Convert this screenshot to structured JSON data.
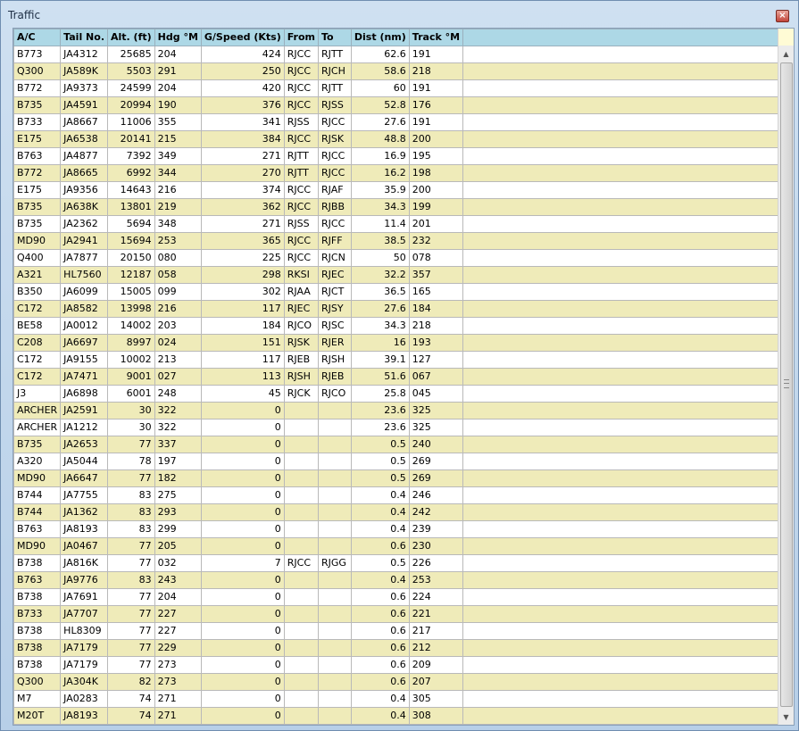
{
  "window": {
    "title": "Traffic",
    "close_glyph": "×"
  },
  "table": {
    "columns": [
      "A/C",
      "Tail No.",
      "Alt. (ft)",
      "Hdg °M",
      "G/Speed (Kts)",
      "From",
      "To",
      "Dist (nm)",
      "Track °M"
    ],
    "rows": [
      [
        "B773",
        "JA4312",
        "25685",
        "204",
        "424",
        "RJCC",
        "RJTT",
        "62.6",
        "191"
      ],
      [
        "Q300",
        "JA589K",
        "5503",
        "291",
        "250",
        "RJCC",
        "RJCH",
        "58.6",
        "218"
      ],
      [
        "B772",
        "JA9373",
        "24599",
        "204",
        "420",
        "RJCC",
        "RJTT",
        "60",
        "191"
      ],
      [
        "B735",
        "JA4591",
        "20994",
        "190",
        "376",
        "RJCC",
        "RJSS",
        "52.8",
        "176"
      ],
      [
        "B733",
        "JA8667",
        "11006",
        "355",
        "341",
        "RJSS",
        "RJCC",
        "27.6",
        "191"
      ],
      [
        "E175",
        "JA6538",
        "20141",
        "215",
        "384",
        "RJCC",
        "RJSK",
        "48.8",
        "200"
      ],
      [
        "B763",
        "JA4877",
        "7392",
        "349",
        "271",
        "RJTT",
        "RJCC",
        "16.9",
        "195"
      ],
      [
        "B772",
        "JA8665",
        "6992",
        "344",
        "270",
        "RJTT",
        "RJCC",
        "16.2",
        "198"
      ],
      [
        "E175",
        "JA9356",
        "14643",
        "216",
        "374",
        "RJCC",
        "RJAF",
        "35.9",
        "200"
      ],
      [
        "B735",
        "JA638K",
        "13801",
        "219",
        "362",
        "RJCC",
        "RJBB",
        "34.3",
        "199"
      ],
      [
        "B735",
        "JA2362",
        "5694",
        "348",
        "271",
        "RJSS",
        "RJCC",
        "11.4",
        "201"
      ],
      [
        "MD90",
        "JA2941",
        "15694",
        "253",
        "365",
        "RJCC",
        "RJFF",
        "38.5",
        "232"
      ],
      [
        "Q400",
        "JA7877",
        "20150",
        "080",
        "225",
        "RJCC",
        "RJCN",
        "50",
        "078"
      ],
      [
        "A321",
        "HL7560",
        "12187",
        "058",
        "298",
        "RKSI",
        "RJEC",
        "32.2",
        "357"
      ],
      [
        "B350",
        "JA6099",
        "15005",
        "099",
        "302",
        "RJAA",
        "RJCT",
        "36.5",
        "165"
      ],
      [
        "C172",
        "JA8582",
        "13998",
        "216",
        "117",
        "RJEC",
        "RJSY",
        "27.6",
        "184"
      ],
      [
        "BE58",
        "JA0012",
        "14002",
        "203",
        "184",
        "RJCO",
        "RJSC",
        "34.3",
        "218"
      ],
      [
        "C208",
        "JA6697",
        "8997",
        "024",
        "151",
        "RJSK",
        "RJER",
        "16",
        "193"
      ],
      [
        "C172",
        "JA9155",
        "10002",
        "213",
        "117",
        "RJEB",
        "RJSH",
        "39.1",
        "127"
      ],
      [
        "C172",
        "JA7471",
        "9001",
        "027",
        "113",
        "RJSH",
        "RJEB",
        "51.6",
        "067"
      ],
      [
        "J3",
        "JA6898",
        "6001",
        "248",
        "45",
        "RJCK",
        "RJCO",
        "25.8",
        "045"
      ],
      [
        "ARCHER",
        "JA2591",
        "30",
        "322",
        "0",
        "",
        "",
        "23.6",
        "325"
      ],
      [
        "ARCHER",
        "JA1212",
        "30",
        "322",
        "0",
        "",
        "",
        "23.6",
        "325"
      ],
      [
        "B735",
        "JA2653",
        "77",
        "337",
        "0",
        "",
        "",
        "0.5",
        "240"
      ],
      [
        "A320",
        "JA5044",
        "78",
        "197",
        "0",
        "",
        "",
        "0.5",
        "269"
      ],
      [
        "MD90",
        "JA6647",
        "77",
        "182",
        "0",
        "",
        "",
        "0.5",
        "269"
      ],
      [
        "B744",
        "JA7755",
        "83",
        "275",
        "0",
        "",
        "",
        "0.4",
        "246"
      ],
      [
        "B744",
        "JA1362",
        "83",
        "293",
        "0",
        "",
        "",
        "0.4",
        "242"
      ],
      [
        "B763",
        "JA8193",
        "83",
        "299",
        "0",
        "",
        "",
        "0.4",
        "239"
      ],
      [
        "MD90",
        "JA0467",
        "77",
        "205",
        "0",
        "",
        "",
        "0.6",
        "230"
      ],
      [
        "B738",
        "JA816K",
        "77",
        "032",
        "7",
        "RJCC",
        "RJGG",
        "0.5",
        "226"
      ],
      [
        "B763",
        "JA9776",
        "83",
        "243",
        "0",
        "",
        "",
        "0.4",
        "253"
      ],
      [
        "B738",
        "JA7691",
        "77",
        "204",
        "0",
        "",
        "",
        "0.6",
        "224"
      ],
      [
        "B733",
        "JA7707",
        "77",
        "227",
        "0",
        "",
        "",
        "0.6",
        "221"
      ],
      [
        "B738",
        "HL8309",
        "77",
        "227",
        "0",
        "",
        "",
        "0.6",
        "217"
      ],
      [
        "B738",
        "JA7179",
        "77",
        "229",
        "0",
        "",
        "",
        "0.6",
        "212"
      ],
      [
        "B738",
        "JA7179",
        "77",
        "273",
        "0",
        "",
        "",
        "0.6",
        "209"
      ],
      [
        "Q300",
        "JA304K",
        "82",
        "273",
        "0",
        "",
        "",
        "0.6",
        "207"
      ],
      [
        "M7",
        "JA0283",
        "74",
        "271",
        "0",
        "",
        "",
        "0.4",
        "305"
      ],
      [
        "M20T",
        "JA8193",
        "74",
        "271",
        "0",
        "",
        "",
        "0.4",
        "308"
      ]
    ]
  },
  "colors": {
    "header_bg": "#add8e6",
    "row_alt_bg": "#efebb9",
    "row_bg": "#ffffff"
  },
  "icons": {
    "close": "close-icon",
    "scroll_up": "arrow-up-icon",
    "scroll_down": "arrow-down-icon"
  }
}
